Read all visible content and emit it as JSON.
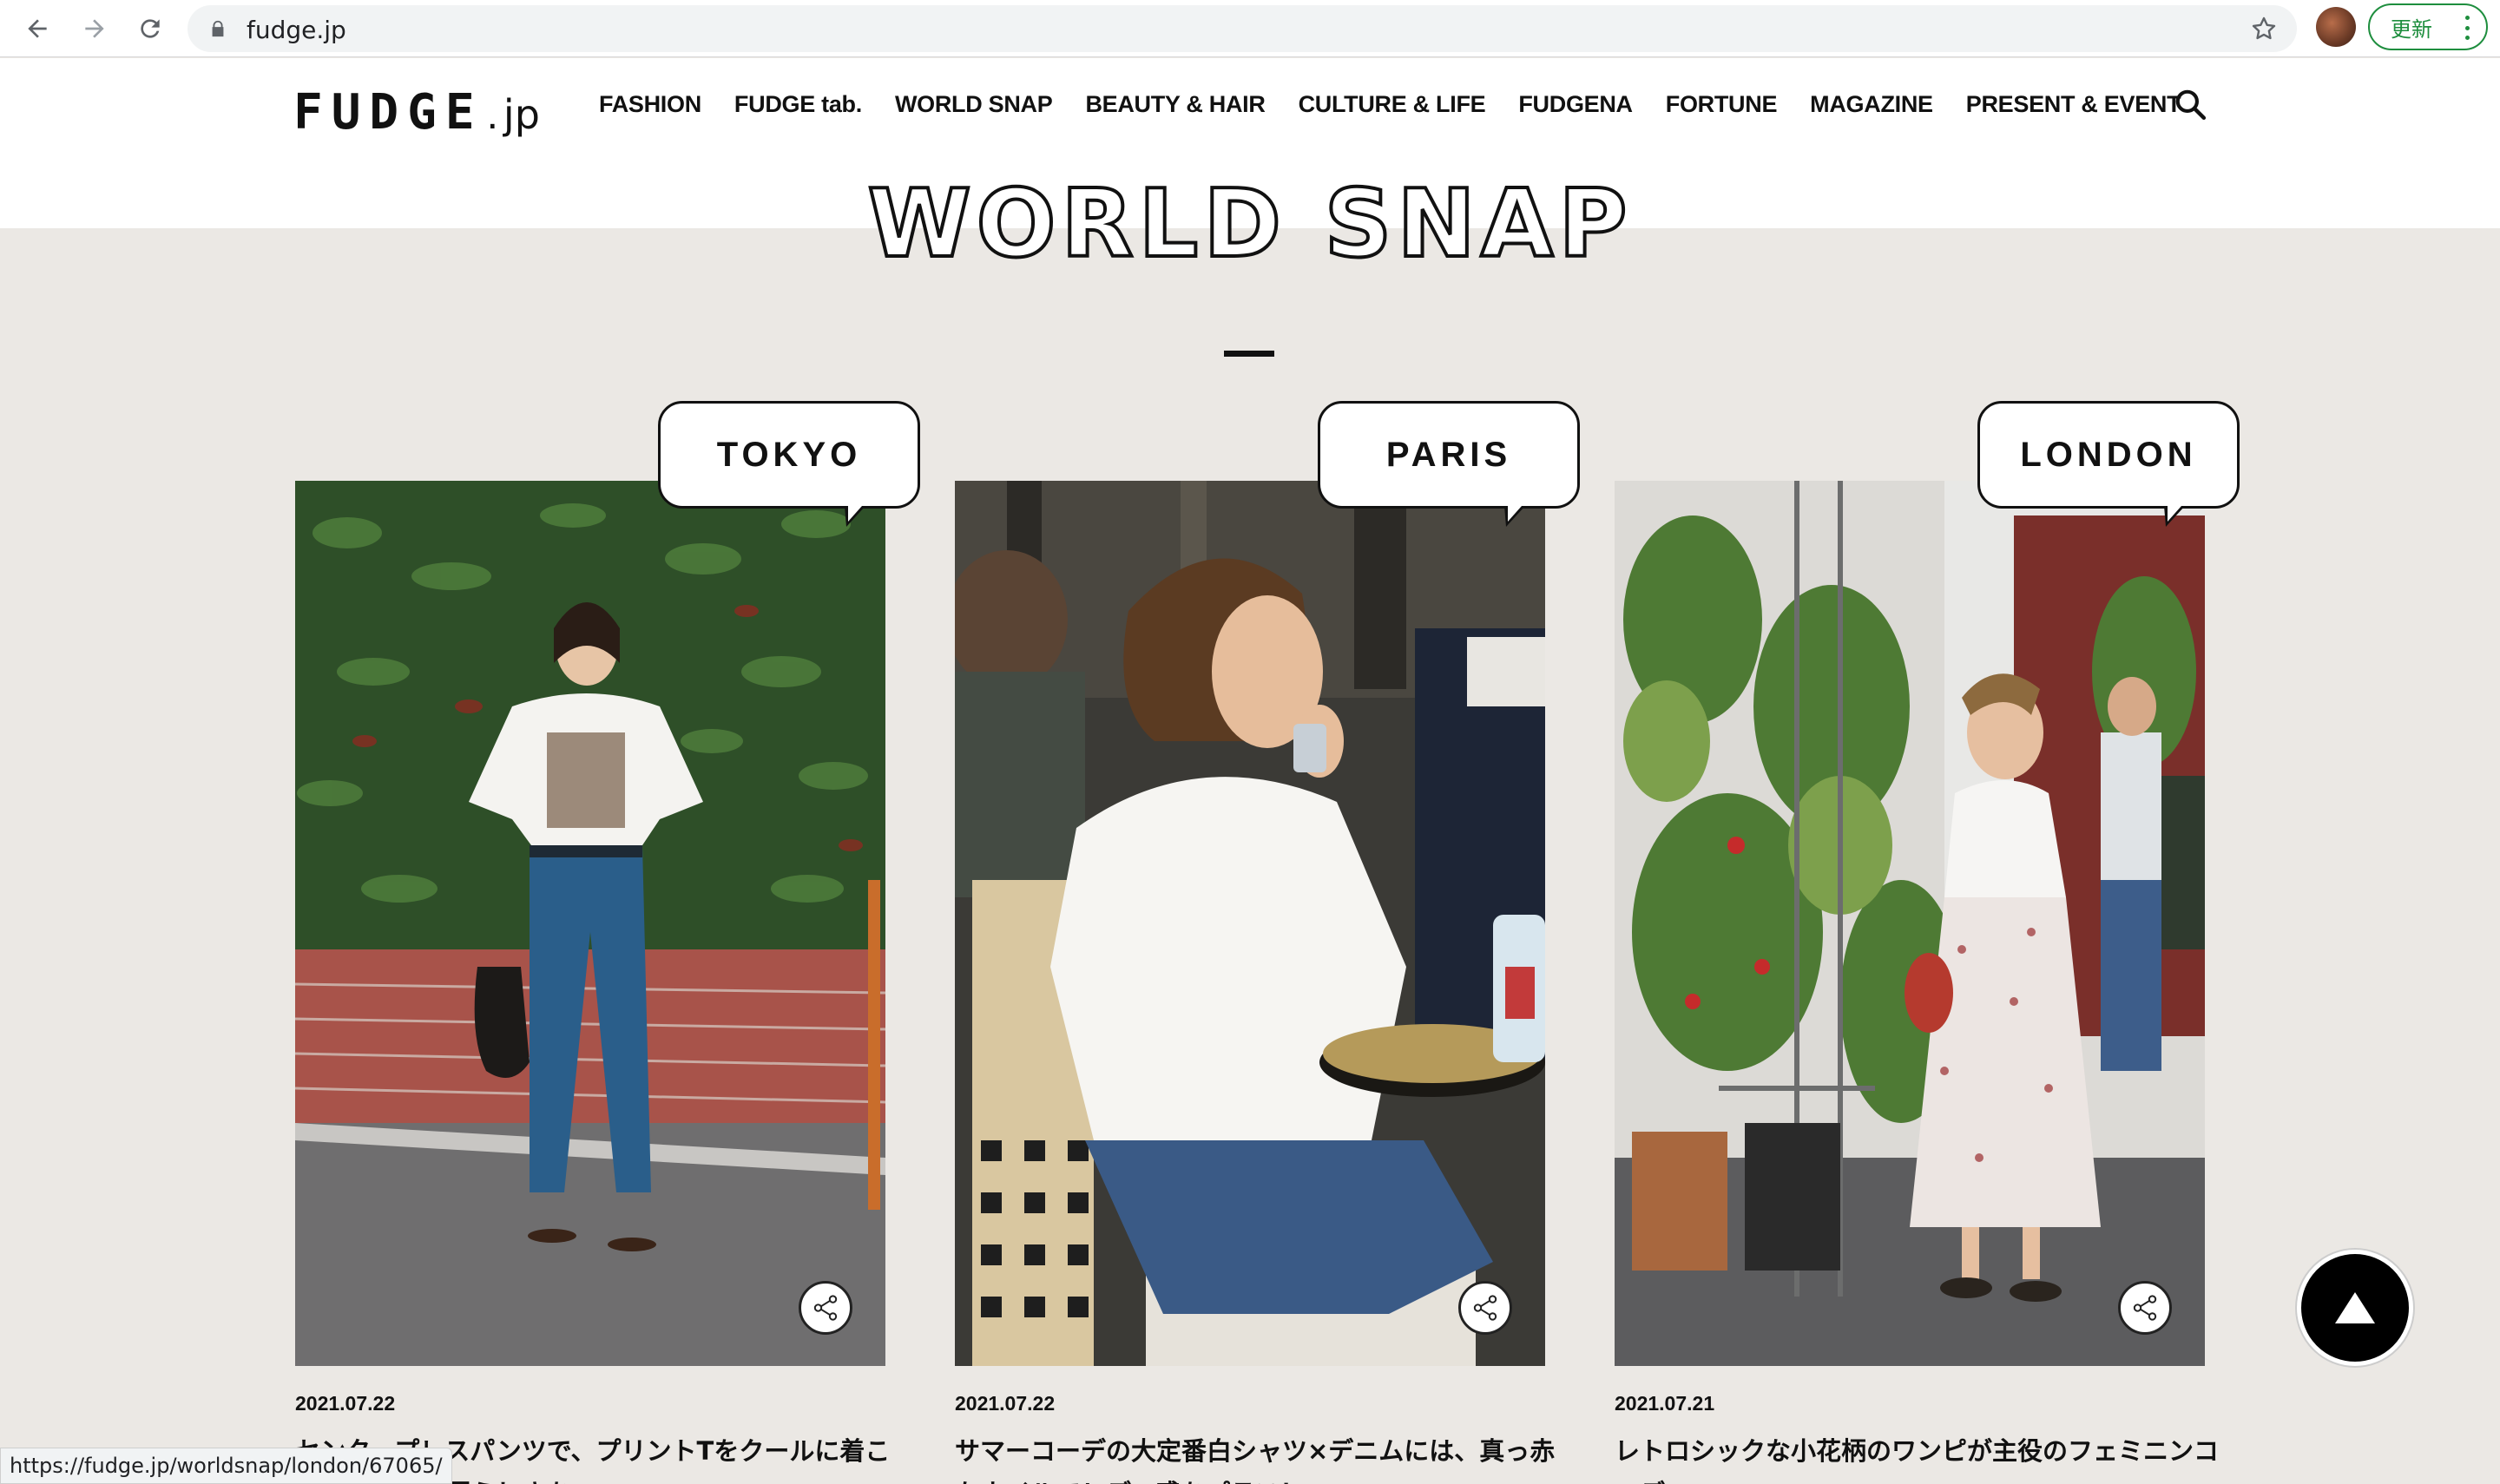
{
  "browser": {
    "url": "fudge.jp",
    "update_label": "更新",
    "status_url": "https://fudge.jp/worldsnap/london/67065/"
  },
  "site": {
    "logo_main": "FUDGE",
    "logo_dot": ".",
    "logo_jp": "jp",
    "nav": [
      "FASHION",
      "FUDGE tab.",
      "WORLD SNAP",
      "BEAUTY & HAIR",
      "CULTURE & LIFE",
      "FUDGENA",
      "FORTUNE",
      "MAGAZINE",
      "PRESENT & EVENT"
    ]
  },
  "section": {
    "title": "WORLD SNAP"
  },
  "cards": [
    {
      "city": "TOKYO",
      "date": "2021.07.22",
      "headline": "センタープレスパンツで、プリントTをクールに着こなしてラフに夏らしさを"
    },
    {
      "city": "PARIS",
      "date": "2021.07.22",
      "headline": "サマーコーデの大定番白シャツ×デニムには、真っ赤なネイルでレディ感をプラス！"
    },
    {
      "city": "LONDON",
      "date": "2021.07.21",
      "headline": "レトロシックな小花柄のワンピが主役のフェミニンコーデ"
    }
  ],
  "colors": {
    "page_bg": "#ebe8e4",
    "header_bg": "#ffffff",
    "text": "#111111",
    "update_green": "#1e8e3e"
  },
  "icons": {
    "back": "back-arrow-icon",
    "forward": "forward-arrow-icon",
    "reload": "reload-icon",
    "lock": "lock-icon",
    "star": "bookmark-star-icon",
    "search": "search-icon",
    "share": "share-icon",
    "top": "scroll-top-icon"
  }
}
